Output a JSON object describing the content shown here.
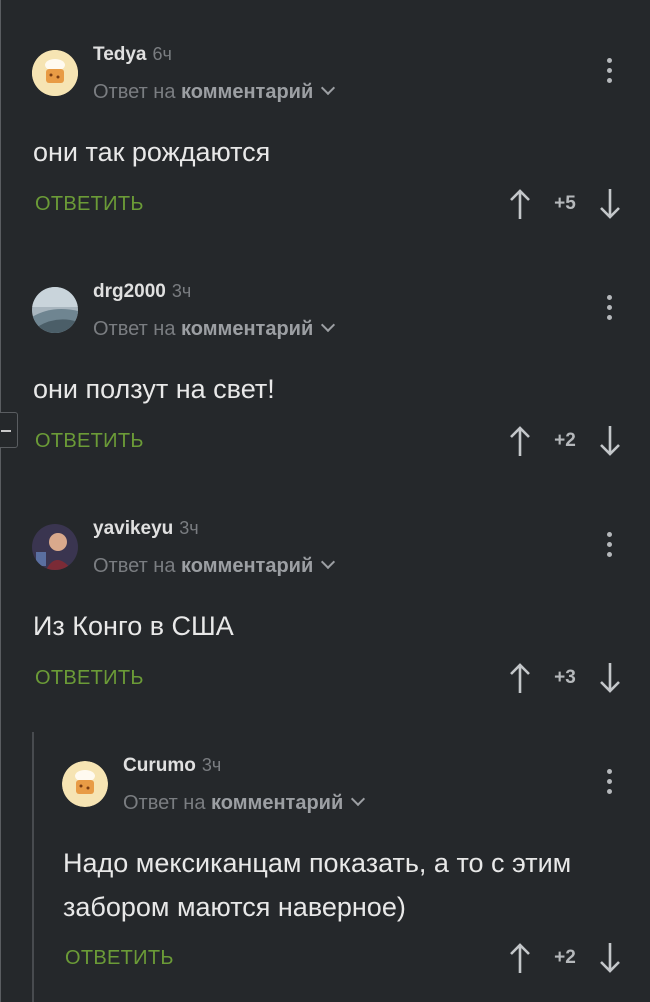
{
  "colors": {
    "background": "#25282b",
    "accent_green": "#6b9b37",
    "muted": "#7a7d81"
  },
  "comments": [
    {
      "author": "Tedya",
      "time": "6ч",
      "reply_prefix": "Ответ на",
      "reply_target": "комментарий",
      "text": "они так рождаются",
      "reply_label": "ОТВЕТИТЬ",
      "score": "+5",
      "avatar": "cookie-chef-avatar"
    },
    {
      "author": "drg2000",
      "time": "3ч",
      "reply_prefix": "Ответ на",
      "reply_target": "комментарий",
      "text": "они ползут на свет!",
      "reply_label": "ОТВЕТИТЬ",
      "score": "+2",
      "avatar": "landscape-avatar"
    },
    {
      "author": "yavikeyu",
      "time": "3ч",
      "reply_prefix": "Ответ на",
      "reply_target": "комментарий",
      "text": "Из Конго в США",
      "reply_label": "ОТВЕТИТЬ",
      "score": "+3",
      "avatar": "photo-avatar"
    },
    {
      "author": "Curumo",
      "time": "3ч",
      "reply_prefix": "Ответ на",
      "reply_target": "комментарий",
      "text": "Надо мексиканцам показать, а то с этим забором маются наверное)",
      "reply_label": "ОТВЕТИТЬ",
      "score": "+2",
      "avatar": "cookie-chef-avatar"
    }
  ]
}
